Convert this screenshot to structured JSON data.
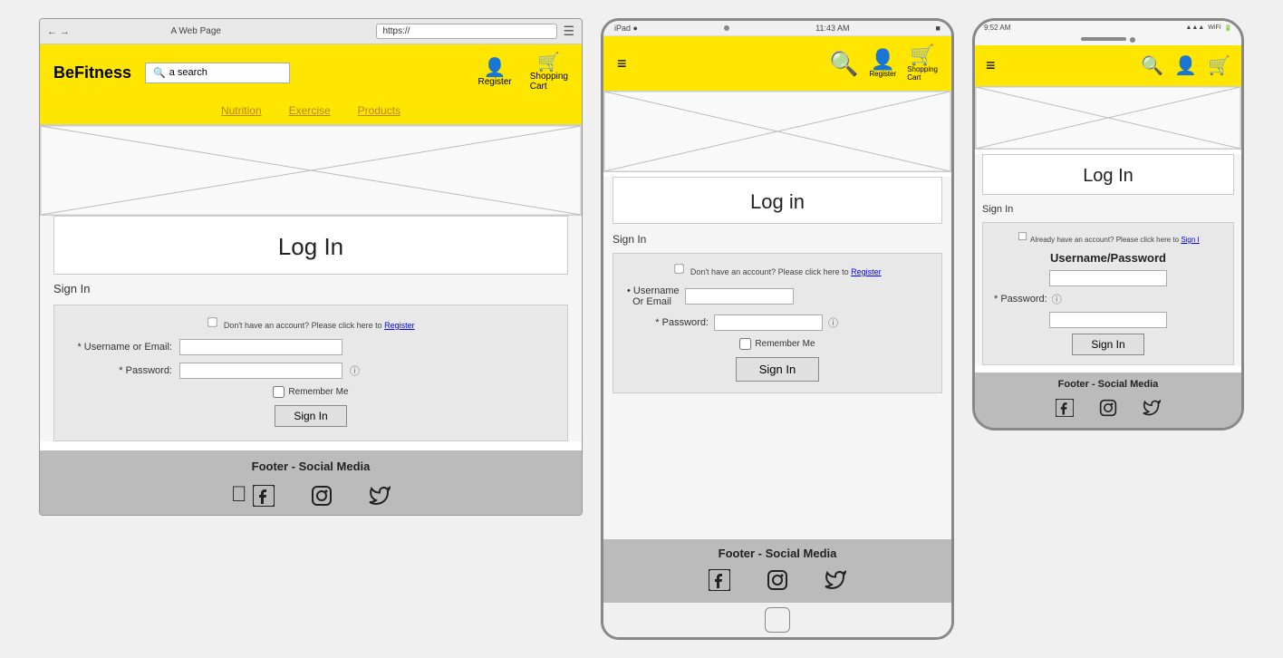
{
  "desktop": {
    "browser_title": "A Web Page",
    "browser_url": "https://",
    "brand": "BeFitness",
    "search_placeholder": "a search",
    "nav_links": [
      "Nutrition",
      "Exercise",
      "Products"
    ],
    "nav_icons": [
      {
        "label": "Register",
        "symbol": "👤+"
      },
      {
        "label": "Shopping\nCart",
        "symbol": "🛒"
      }
    ],
    "page_title": "Log In",
    "sign_in_label": "Sign In",
    "form": {
      "register_notice": "Don't have an account? Please click here to ",
      "register_link": "Register",
      "username_label": "* Username or Email:",
      "password_label": "* Password:",
      "remember_label": "Remember Me",
      "sign_in_btn": "Sign In"
    },
    "footer": {
      "title": "Footer - Social Media"
    }
  },
  "tablet": {
    "status_left": "iPad ●",
    "status_center": "11:43 AM",
    "status_right": "■",
    "page_title": "Log in",
    "sign_in_label": "Sign In",
    "form": {
      "register_notice": "Don't have an account? Please click here to ",
      "register_link": "Register",
      "username_label": "• Username\n  Or Email",
      "password_label": "* Password:",
      "remember_label": "Remember Me",
      "sign_in_btn": "Sign In"
    },
    "footer": {
      "title": "Footer - Social Media"
    }
  },
  "mobile": {
    "status_left": "9:52 AM",
    "status_right": "▲▲▲ WiFi 🔋",
    "page_title": "Log In",
    "sign_in_label": "Sign In",
    "form": {
      "register_notice": "Already have an account? Please click here to ",
      "register_link": "Sign I",
      "username_section_label": "Username/Password",
      "password_label": "* Password:",
      "sign_in_btn": "Sign In"
    },
    "footer": {
      "title": "Footer - Social Media"
    }
  }
}
